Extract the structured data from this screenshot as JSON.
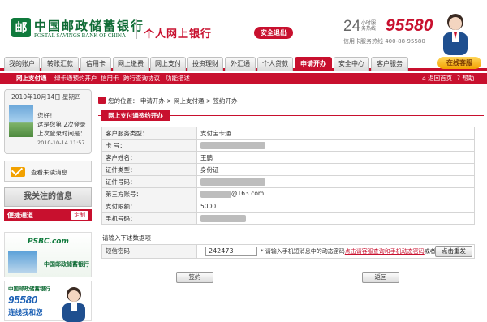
{
  "header": {
    "bank_name_cn": "中国邮政储蓄银行",
    "bank_name_en": "POSTAL SAVINGS BANK OF CHINA",
    "section": "个人网上银行",
    "logout": "安全退出",
    "hotline_24": "24",
    "hotline_24_label": "小时服务热线",
    "hotline_number": "95580",
    "card_hotline": "信用卡服务热线  400-88-95580"
  },
  "nav": {
    "tabs": [
      "我的账户",
      "转账汇款",
      "信用卡",
      "网上缴费",
      "网上支付",
      "投资理财",
      "外汇通",
      "个人贷款",
      "申请开办",
      "安全中心",
      "客户服务"
    ],
    "active_index": 8,
    "online_service": "在线客服"
  },
  "subnav": {
    "items": [
      "网上支付通",
      "绿卡通预约开户",
      "信用卡",
      "跨行查询协议",
      "功能描述"
    ],
    "back_home": "返回首页",
    "help": "帮助"
  },
  "sidebar": {
    "date": "2010年10月14日 星期四",
    "greeting": "您好！",
    "login_count": "这是您第 2次登录",
    "last_login_label": "上次登录时间是：",
    "last_login_time": "2010-10-14 11:57",
    "view_messages": "查看未读消息",
    "follow_title": "我关注的信息",
    "quick_channel": "便捷通道",
    "customize": "定制",
    "ad_psbc": "PSBC.com",
    "ad_bank_cn": "中国邮政储蓄银行",
    "ad2_bank": "中国邮政储蓄银行",
    "ad2_number": "95580",
    "ad2_slogan": "连线我和您"
  },
  "main": {
    "location_label": "您的位置：",
    "breadcrumb": [
      "申请开办",
      "网上支付通",
      "签约开办"
    ],
    "section_title": "网上支付通签约开办",
    "rows": [
      {
        "label": "客户服务类型：",
        "value": "支付宝卡通"
      },
      {
        "label": "卡  号：",
        "value": ""
      },
      {
        "label": "客户姓名：",
        "value": "王鹏"
      },
      {
        "label": "证件类型：",
        "value": "身份证"
      },
      {
        "label": "证件号码：",
        "value": ""
      },
      {
        "label": "第三方账号：",
        "value": "@163.com"
      },
      {
        "label": "支付限额：",
        "value": "5000"
      },
      {
        "label": "手机号码：",
        "value": ""
      }
    ],
    "note": "请输入下述数据项",
    "sms_label": "短信密码",
    "sms_value": "242473",
    "sms_hint_pre": "* 请输入手机短消息中的动态密码",
    "sms_hint_link": "点击请客服查询和手机动态密码",
    "sms_hint_post": "或者",
    "resend_button": "点击重发",
    "sign_button": "签约",
    "back_button": "返回"
  }
}
